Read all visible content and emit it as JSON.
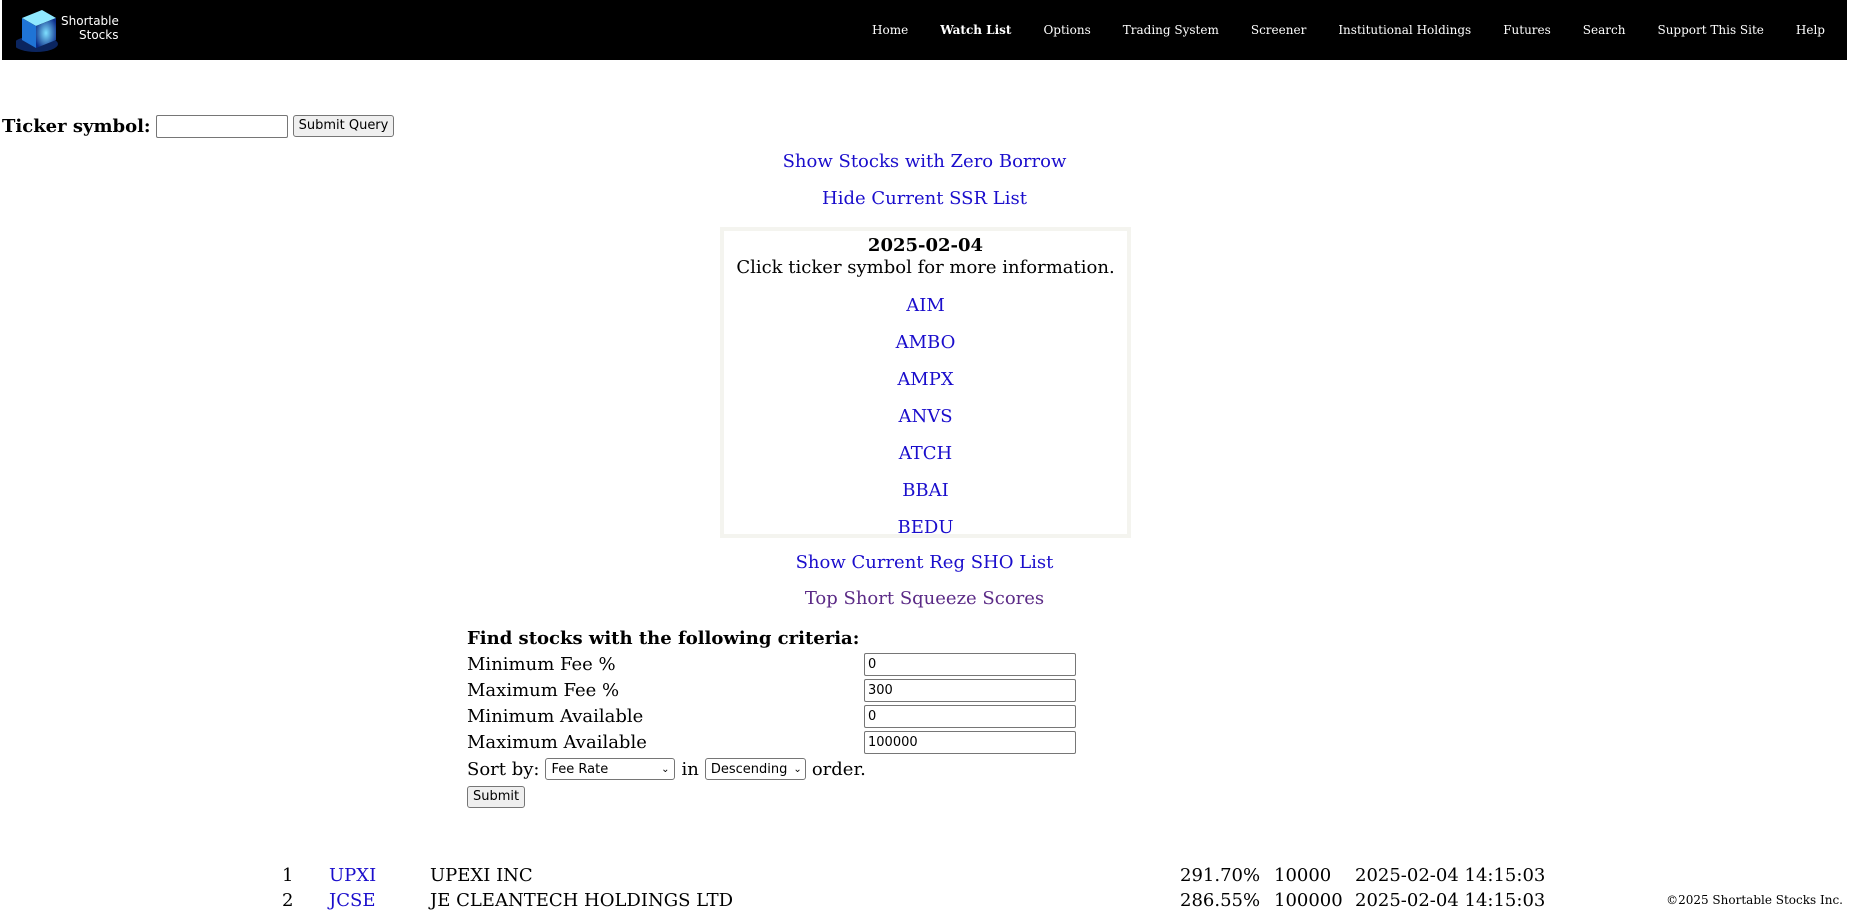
{
  "brand": {
    "line1": "Shortable",
    "line2": "Stocks"
  },
  "nav": [
    {
      "label": "Home",
      "active": false
    },
    {
      "label": "Watch List",
      "active": true
    },
    {
      "label": "Options",
      "active": false
    },
    {
      "label": "Trading System",
      "active": false
    },
    {
      "label": "Screener",
      "active": false
    },
    {
      "label": "Institutional Holdings",
      "active": false
    },
    {
      "label": "Futures",
      "active": false
    },
    {
      "label": "Search",
      "active": false
    },
    {
      "label": "Support This Site",
      "active": false
    },
    {
      "label": "Help",
      "active": false
    }
  ],
  "ticker": {
    "label": "Ticker symbol:",
    "value": "",
    "submit_label": "Submit Query"
  },
  "links": {
    "zero_borrow": "Show Stocks with Zero Borrow",
    "hide_ssr": "Hide Current SSR List",
    "reg_sho": "Show Current Reg SHO List",
    "squeeze": "Top Short Squeeze Scores"
  },
  "ssr": {
    "date": "2025-02-04",
    "note": "Click ticker symbol for more information.",
    "items": [
      "AIM",
      "AMBO",
      "AMPX",
      "ANVS",
      "ATCH",
      "BBAI",
      "BEDU"
    ]
  },
  "criteria": {
    "title": "Find stocks with the following criteria:",
    "fields": [
      {
        "label": "Minimum Fee %",
        "value": "0"
      },
      {
        "label": "Maximum Fee %",
        "value": "300"
      },
      {
        "label": "Minimum Available",
        "value": "0"
      },
      {
        "label": "Maximum Available",
        "value": "100000"
      }
    ],
    "sort_label": "Sort by:",
    "sort_value": "Fee Rate",
    "in_label": "in",
    "order_value": "Descending",
    "order_label": "order.",
    "submit_label": "Submit"
  },
  "results": [
    {
      "num": "1",
      "symbol": "UPXI",
      "name": "UPEXI INC",
      "fee": "291.70%",
      "available": "10000",
      "time": "2025-02-04 14:15:03"
    },
    {
      "num": "2",
      "symbol": "JCSE",
      "name": "JE CLEANTECH HOLDINGS LTD",
      "fee": "286.55%",
      "available": "100000",
      "time": "2025-02-04 14:15:03"
    }
  ],
  "footer": "©2025 Shortable Stocks Inc.",
  "colors": {
    "link": "#1a0dcc",
    "visited": "#5b2a86",
    "nav_bg": "#000000"
  }
}
